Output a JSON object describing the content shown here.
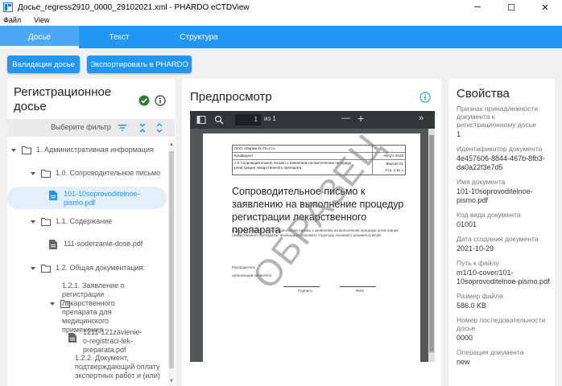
{
  "window": {
    "title": "Досье_regress2910_0000_29102021.xml - PHARDO eCTDView",
    "minimize": "─",
    "maximize": "☐",
    "close": "✕"
  },
  "menu": {
    "file": "Файл",
    "view": "View"
  },
  "tabs": [
    {
      "label": "Досье",
      "active": true
    },
    {
      "label": "Текст",
      "active": false
    },
    {
      "label": "Структура",
      "active": false
    }
  ],
  "toolbar": {
    "validate_label": "Валидация досье",
    "export_label": "Экспортировать в PHARDO"
  },
  "left_panel": {
    "title": "Регистрационное досье",
    "filter_placeholder": "Выберите фильтр",
    "tree": [
      {
        "label": "1. Административная информация",
        "type": "folder"
      },
      {
        "label": "1.0. Сопроводительное письмо",
        "type": "folder"
      },
      {
        "label": "101-10soprovoditelnoe-pismo.pdf",
        "type": "file",
        "selected": true
      },
      {
        "label": "1.1. Содержание",
        "type": "folder"
      },
      {
        "label": "111-soderzanie-dose.pdf",
        "type": "file"
      },
      {
        "label": "1.2. Общая документация:",
        "type": "folder"
      },
      {
        "label": "1.2.1. Заявление о регистрации лекарственного препарата для медицинского применения",
        "type": "folder"
      },
      {
        "label": "1211-121zavlenie-o-registraci-lek-preparata.pdf",
        "type": "file"
      },
      {
        "label": "1.2.2. Документ, подтверждающий оплату экспертных работ и (или)",
        "type": "folder"
      }
    ]
  },
  "preview": {
    "title": "Предпросмотр",
    "page_current": "1",
    "page_of": "из 1",
    "zoom_out": "—",
    "zoom_in": "+",
    "doc": {
      "company": "ООО «Фирма Ко По Со»",
      "company_right": "",
      "row2_left": "Конфидент",
      "row2_right": "Август 2019",
      "row3_left": "1.0 Сопроводительное письмо к заявлению на выполнение процедур регистрации лекарственного препарата",
      "row3_right_a": "Версия 01",
      "row3_right_b": "Стр. 1 из 1",
      "heading": "Сопроводительное письмо к заявлению на выполнение процедур регистрации лекарственного препарата",
      "body": "В данном разделе «Сопроводительное письмо к заявлению на выполнение процедур регистрации лекарственного препарата» необходимо изложить структуру основного документа ВАЗЕ",
      "sig_role": "Руководитель",
      "sig_org": "организации-заявителя",
      "sig_sign": "Подпись",
      "sig_name": "ФИО",
      "watermark": "ОБРАЗЕЦ"
    }
  },
  "properties": {
    "title": "Свойства",
    "items": [
      {
        "label": "Признак принадлежности документа к регистрационному досье",
        "value": "1"
      },
      {
        "label": "Идентификатор документа",
        "value": "4e457606-8844-467b-8fb3-da0a22f3e7d5"
      },
      {
        "label": "Имя документа",
        "value": "101-10soprovoditelnoe-pismo.pdf"
      },
      {
        "label": "Код вида документа",
        "value": "01001"
      },
      {
        "label": "Дата создания документа",
        "value": "2021-10-29"
      },
      {
        "label": "Путь к файлу",
        "value": "m1/10-cover/101-10soprovoditelnoe-pismo.pdf"
      },
      {
        "label": "Размер файла",
        "value": "586.0 KB"
      },
      {
        "label": "Номер последовательности досье",
        "value": "0000"
      },
      {
        "label": "Операция документа",
        "value": "new"
      }
    ]
  },
  "colors": {
    "accent": "#2196f3",
    "success": "#2e7d32"
  }
}
